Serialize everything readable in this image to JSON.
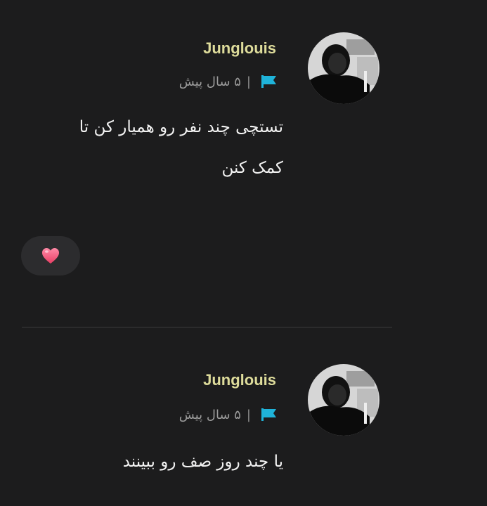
{
  "comments": [
    {
      "username": "Junglouis",
      "time": "۵ سال پیش",
      "separator": "|",
      "text_lines": [
        "تستچی چند نفر رو همیار کن تا",
        "کمک کنن"
      ],
      "reaction_icon": "heart-emoji"
    },
    {
      "username": "Junglouis",
      "time": "۵ سال پیش",
      "separator": "|",
      "text_lines": [
        "یا چند روز صف رو ببینند"
      ]
    }
  ],
  "colors": {
    "background": "#1c1c1d",
    "username": "#dedc9b",
    "flag": "#1fb3d9",
    "text": "#f2f2f2",
    "meta": "#9a9a9a",
    "heart": "#f0577a"
  }
}
